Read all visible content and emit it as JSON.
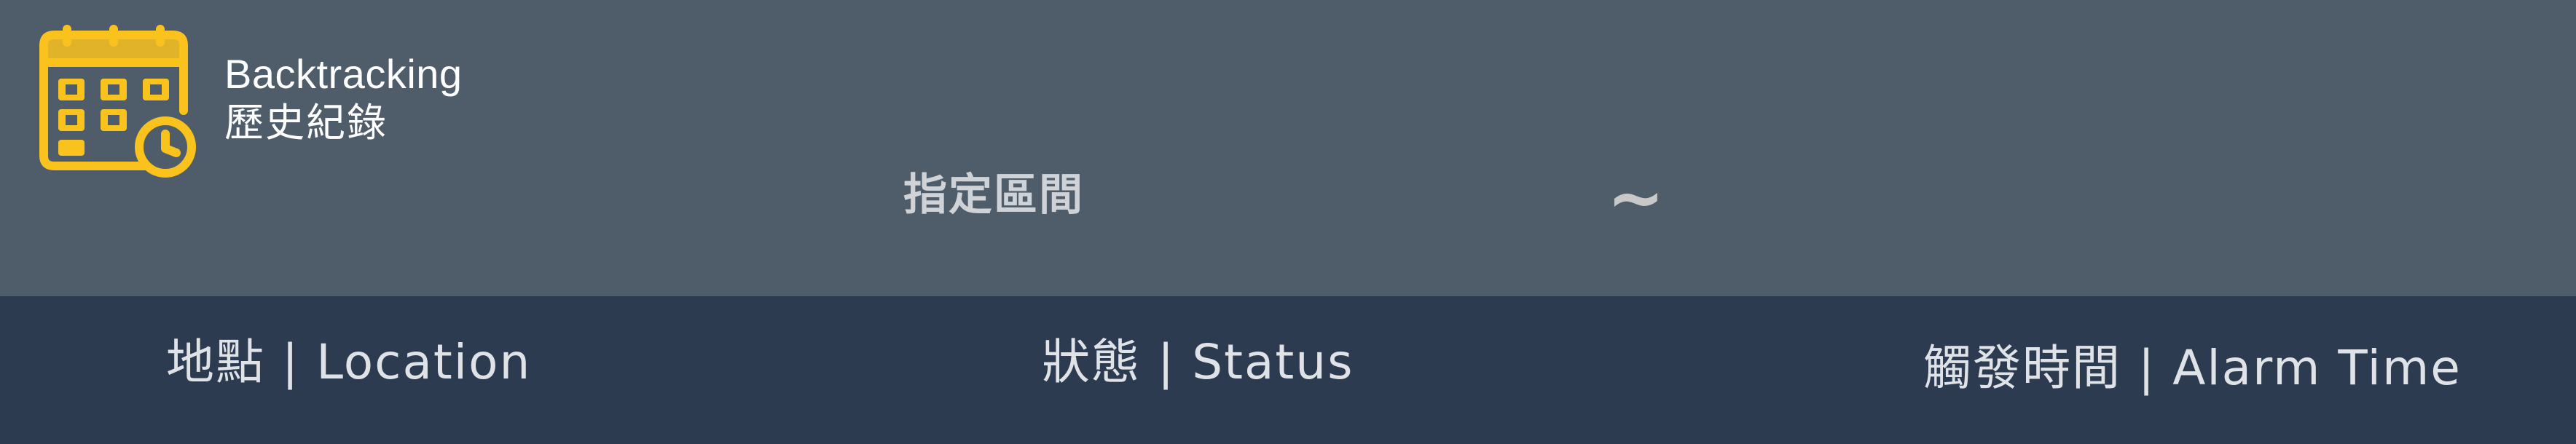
{
  "app": {
    "title_en": "Backtracking",
    "title_zh": "歷史紀錄"
  },
  "icons": {
    "logo": "calendar-clock-icon"
  },
  "colors": {
    "top_bar": "#4f5d6b",
    "header_bar": "#2c3b4f",
    "logo_accent": "#f9c21c"
  },
  "filter": {
    "range_label": "指定區間",
    "separator": "~",
    "start_value": "",
    "end_value": ""
  },
  "table": {
    "columns": [
      "地點 | Location",
      "狀態 | Status",
      "觸發時間 | Alarm Time"
    ]
  }
}
